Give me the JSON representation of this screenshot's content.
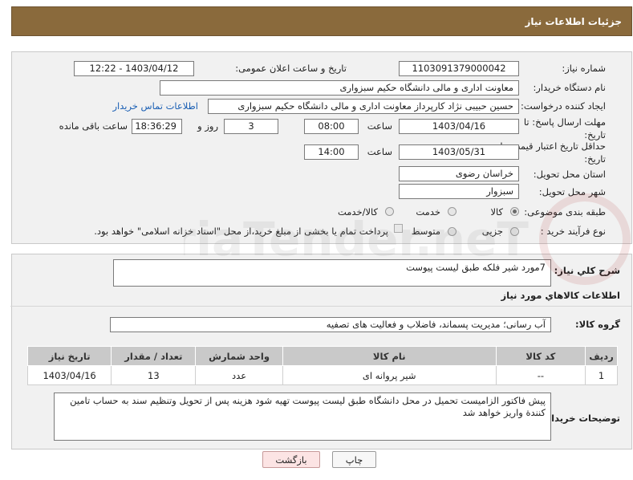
{
  "page_title": "جزئیات اطلاعات نیاز",
  "labels": {
    "need_number": "شماره نیاز:",
    "announce_datetime": "تاریخ و ساعت اعلان عمومی:",
    "buyer_org": "نام دستگاه خریدار:",
    "requester": "ایجاد کننده درخواست:",
    "buyer_contact": "اطلاعات تماس خریدار",
    "reply_deadline_line1": "مهلت ارسال پاسخ: تا",
    "reply_deadline_line2": "تاریخ:",
    "time": "ساعت",
    "day_and": "روز و",
    "hours_remaining": "ساعت باقی مانده",
    "price_validity_line1": "حداقل تاریخ اعتبار قیمت: تا",
    "price_validity_line2": "تاریخ:",
    "delivery_province": "استان محل تحویل:",
    "delivery_city": "شهر محل تحویل:",
    "category": "طبقه بندی موضوعی:",
    "purchase_process": "نوع فرآیند خرید :",
    "general_desc": "شرح کلي نياز:",
    "goods_info": "اطلاعات کالاهاي مورد نياز",
    "goods_group": "گروه کالا:",
    "buyer_notes": "توضیحات خریدار:"
  },
  "values": {
    "need_number": "1103091379000042",
    "announce_datetime": "1403/04/12 - 12:22",
    "buyer_org": "معاونت اداری و مالی دانشگاه حکیم سبزواری",
    "requester": "حسین حبیبی نژاد کارپرداز معاونت اداری و مالی دانشگاه حکیم سبزواری",
    "reply_date": "1403/04/16",
    "reply_time": "08:00",
    "reply_days": "3",
    "reply_remaining": "18:36:29",
    "price_date": "1403/05/31",
    "price_time": "14:00",
    "delivery_province": "خراسان رضوی",
    "delivery_city": "سبزوار",
    "general_desc": "7مورد شیر فلکه طبق لیست پیوست",
    "goods_group": "آب رسانی؛ مدیریت پسماند، فاضلاب و فعالیت های تصفیه",
    "buyer_notes": "پیش فاکتور الزامیست تحمیل در محل دانشگاه طبق لیست پیوست تهیه شود هزینه پس از تحویل وتنظیم سند به حساب تامین کنندة واریز خواهد شد"
  },
  "category_options": [
    "کالا",
    "خدمت",
    "کالا/خدمت"
  ],
  "category_selected": "کالا",
  "process_options": [
    "جزیی",
    "متوسط"
  ],
  "process_selected": "جزیی",
  "payment_note": "پرداخت تمام یا بخشی از مبلغ خرید،از محل \"اسناد خزانه اسلامی\" خواهد بود.",
  "table": {
    "headers": [
      "ردیف",
      "کد کالا",
      "نام کالا",
      "واحد شمارش",
      "تعداد / مقدار",
      "تاریخ نیاز"
    ],
    "rows": [
      [
        "1",
        "--",
        "شیر پروانه ای",
        "عدد",
        "13",
        "1403/04/16"
      ]
    ]
  },
  "buttons": {
    "print": "چاپ",
    "back": "بازگشت"
  },
  "watermark_text": "AriaTender.neT",
  "colors": {
    "title_bar": "#8a6a3c",
    "panel_bg": "#f1f1f1",
    "table_header": "#c9c9c9",
    "back_button": "#fce4e4",
    "link": "#1a5fb4"
  }
}
